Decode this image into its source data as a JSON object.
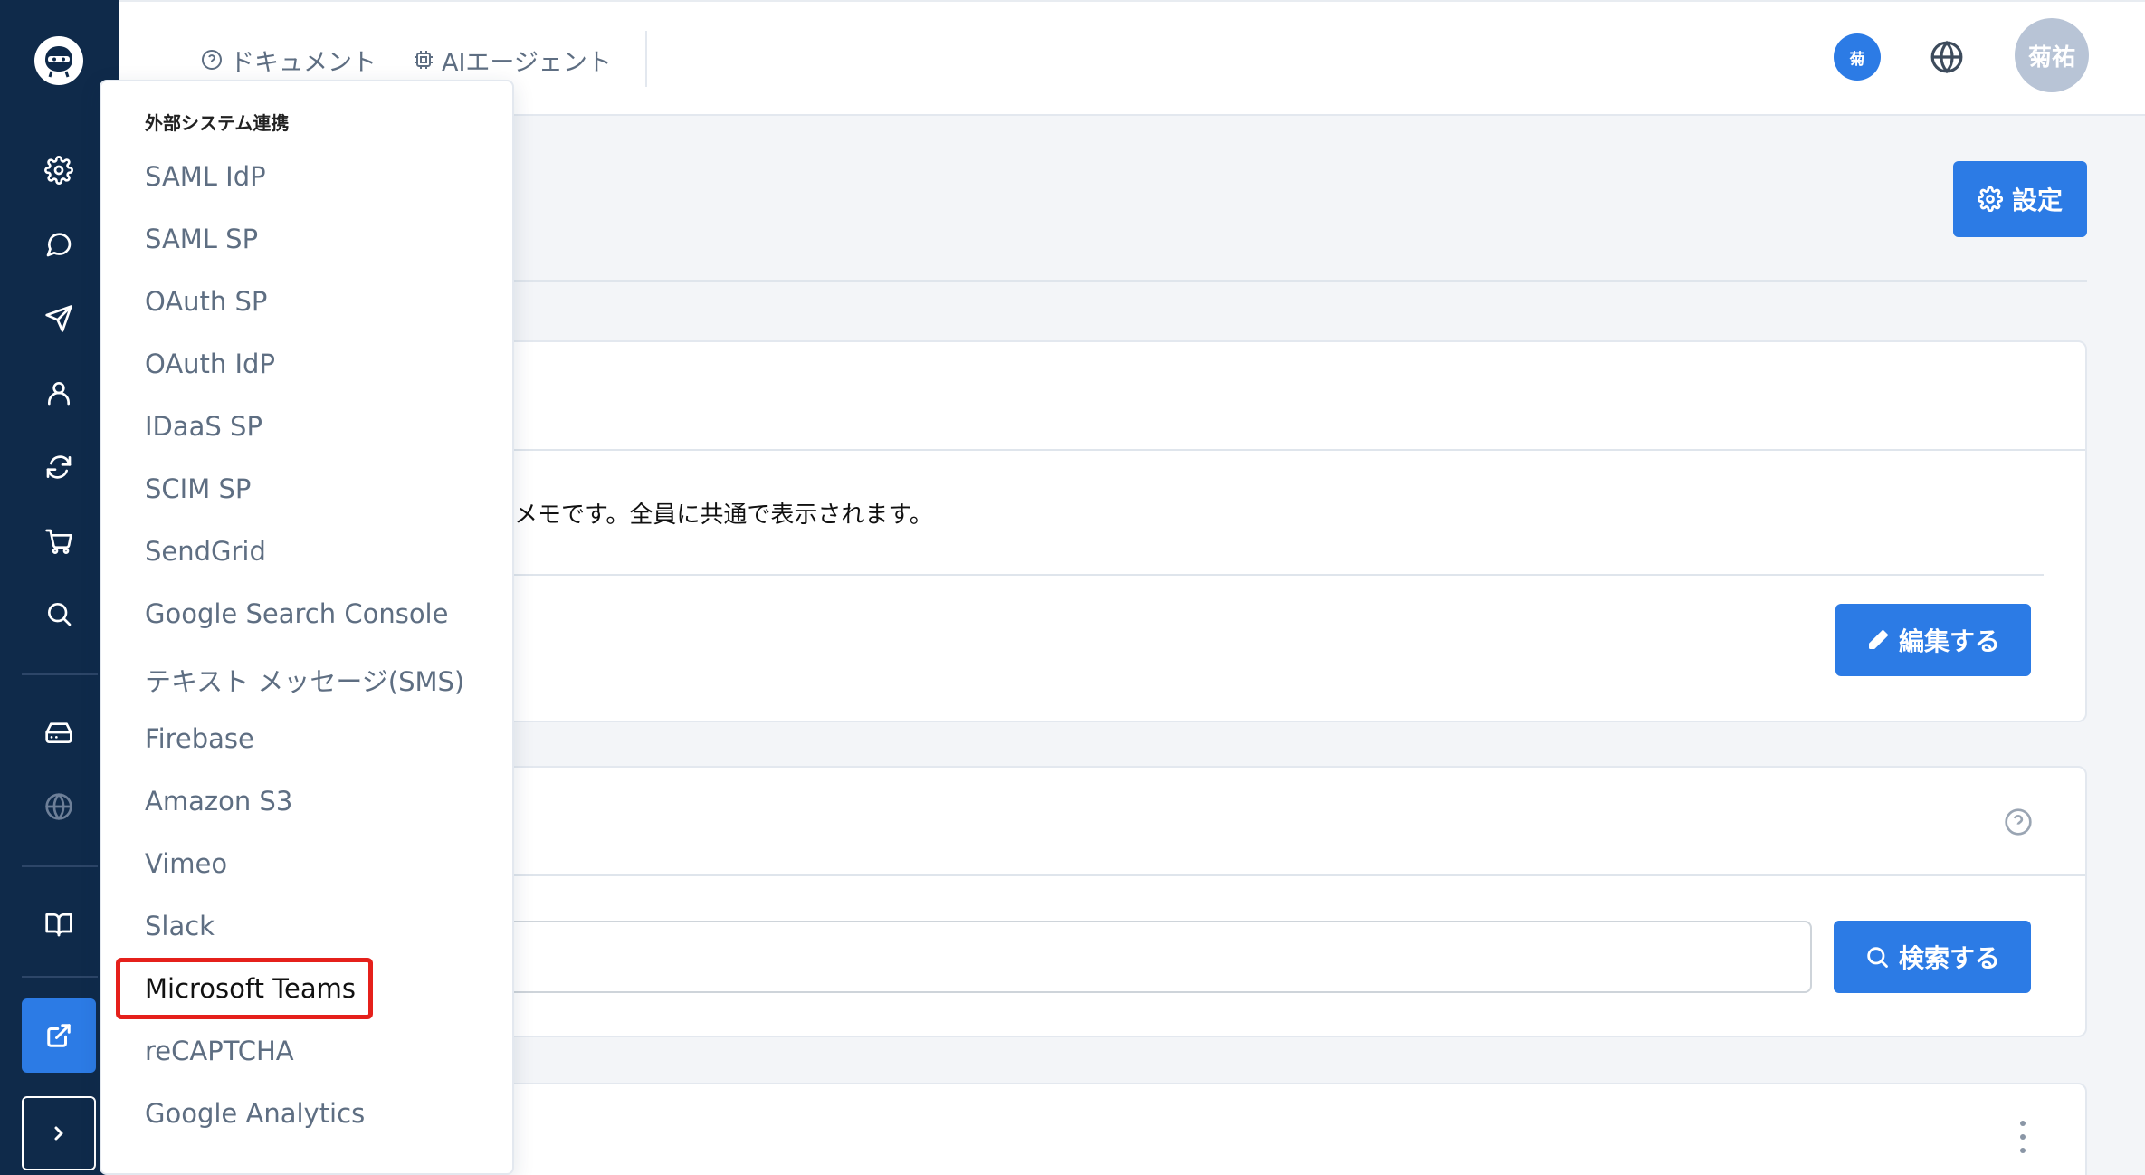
{
  "topbar": {
    "docs_label": "ドキュメント",
    "ai_agent_label": "AIエージェント",
    "user_badge": "菊",
    "avatar_text": "菊祐"
  },
  "main": {
    "settings_button": "設定",
    "memo_text": "メモです。全員に共通で表示されます。",
    "edit_button": "編集する",
    "search_button": "検索する"
  },
  "dropdown": {
    "header": "外部システム連携",
    "items": [
      "SAML IdP",
      "SAML SP",
      "OAuth SP",
      "OAuth IdP",
      "IDaaS SP",
      "SCIM SP",
      "SendGrid",
      "Google Search Console",
      "テキスト メッセージ(SMS)",
      "Firebase",
      "Amazon S3",
      "Vimeo",
      "Slack",
      "Microsoft Teams",
      "reCAPTCHA",
      "Google Analytics"
    ]
  },
  "colors": {
    "sidebar": "#0f2a4a",
    "accent": "#2c7be5",
    "highlight_border": "#e5201b"
  }
}
